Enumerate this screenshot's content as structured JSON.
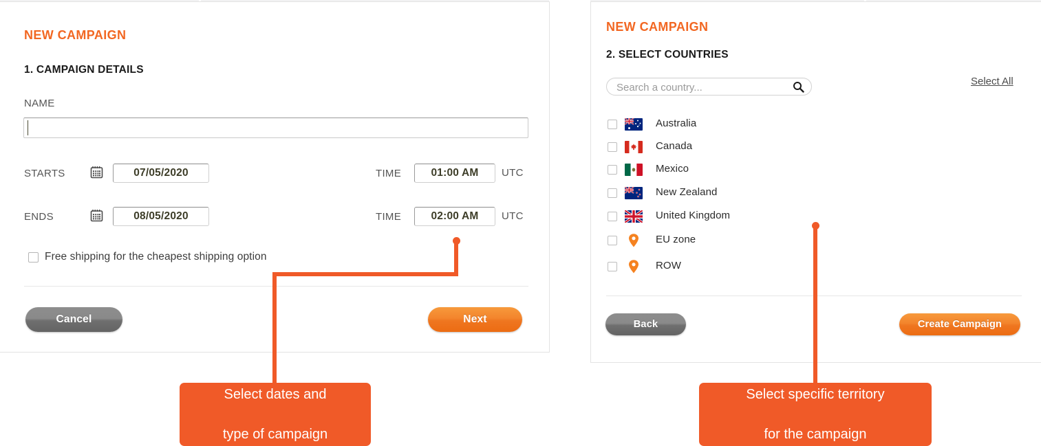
{
  "left_panel": {
    "campaign_title": "NEW CAMPAIGN",
    "section_title": "1. CAMPAIGN DETAILS",
    "name_label": "NAME",
    "name_value": "",
    "name_placeholder": "",
    "starts_label": "STARTS",
    "starts_date": "07/05/2020",
    "starts_time_label": "TIME",
    "starts_time": "01:00 AM",
    "starts_tz": "UTC",
    "ends_label": "ENDS",
    "ends_date": "08/05/2020",
    "ends_time_label": "TIME",
    "ends_time": "02:00 AM",
    "ends_tz": "UTC",
    "free_shipping_label": "Free shipping for the cheapest shipping option",
    "free_shipping_checked": false,
    "cancel_label": "Cancel",
    "next_label": "Next"
  },
  "right_panel": {
    "campaign_title": "NEW CAMPAIGN",
    "section_title": "2. SELECT COUNTRIES",
    "search_value": "",
    "search_placeholder": "Search a country...",
    "select_all_label": "Select All",
    "countries": [
      {
        "name": "Australia",
        "flag": "flag-australia",
        "checked": false
      },
      {
        "name": "Canada",
        "flag": "flag-canada",
        "checked": false
      },
      {
        "name": "Mexico",
        "flag": "flag-mexico",
        "checked": false
      },
      {
        "name": "New Zealand",
        "flag": "flag-new-zealand",
        "checked": false
      },
      {
        "name": "United Kingdom",
        "flag": "flag-united-kingdom",
        "checked": false
      },
      {
        "name": "EU zone",
        "flag": "map-pin",
        "checked": false
      },
      {
        "name": "ROW",
        "flag": "map-pin",
        "checked": false
      }
    ],
    "back_label": "Back",
    "create_label": "Create Campaign"
  },
  "callouts": [
    {
      "line1": "Select dates and",
      "line2": "type of campaign"
    },
    {
      "line1": "Select specific territory",
      "line2": "for the campaign"
    }
  ],
  "colors": {
    "brand_orange": "#f26722",
    "callout_orange": "#f05a28",
    "button_grey": "#7d7d7d",
    "text_dark": "#2b2b2b",
    "label_grey": "#555555",
    "input_text": "#3d3d28",
    "card_border": "#e3e3e3"
  },
  "icons": {
    "calendar": "calendar-icon",
    "search": "search-icon",
    "checkbox": "checkbox-icon"
  }
}
